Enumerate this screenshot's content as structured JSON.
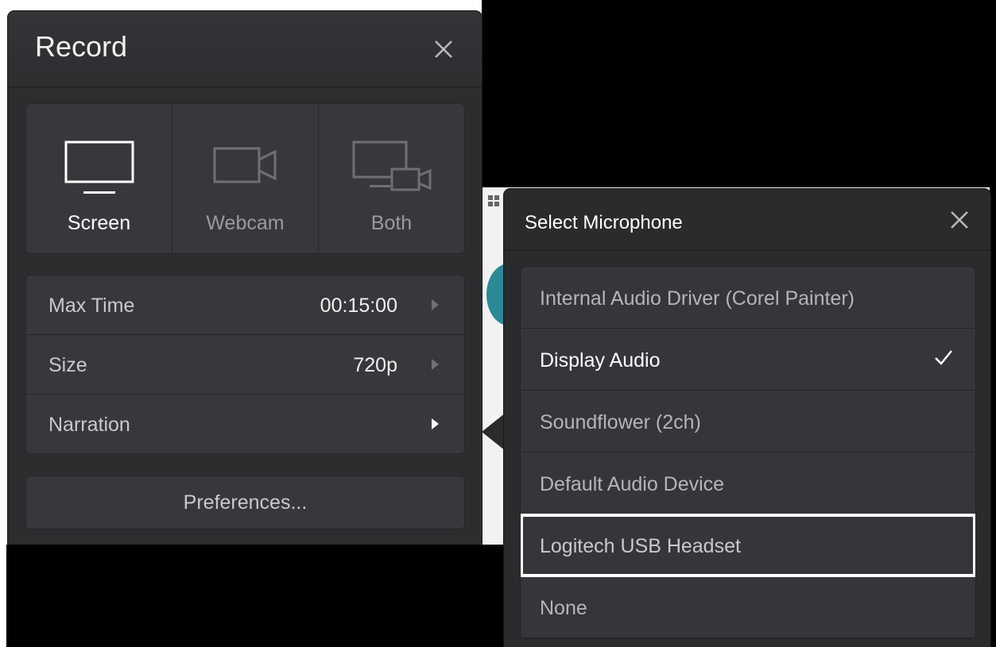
{
  "record": {
    "title": "Record",
    "sources": [
      {
        "label": "Screen",
        "icon": "monitor-icon",
        "active": true
      },
      {
        "label": "Webcam",
        "icon": "webcam-icon",
        "active": false
      },
      {
        "label": "Both",
        "icon": "screen-webcam-icon",
        "active": false
      }
    ],
    "settings": [
      {
        "label": "Max Time",
        "value": "00:15:00"
      },
      {
        "label": "Size",
        "value": "720p"
      },
      {
        "label": "Narration",
        "value": ""
      }
    ],
    "preferences_label": "Preferences..."
  },
  "microphone": {
    "title": "Select Microphone",
    "items": [
      {
        "label": "Internal Audio Driver (Corel Painter)",
        "selected": false
      },
      {
        "label": "Display Audio",
        "selected": true
      },
      {
        "label": "Soundflower (2ch)",
        "selected": false
      },
      {
        "label": "Default Audio Device",
        "selected": false
      },
      {
        "label": "Logitech USB Headset",
        "selected": false,
        "focused": true
      },
      {
        "label": "None",
        "selected": false
      }
    ]
  },
  "colors": {
    "panel_bg": "#2c2d2f",
    "group_bg": "#37383b",
    "active_text": "#ffffff",
    "inactive_text": "#9a9b9d"
  }
}
